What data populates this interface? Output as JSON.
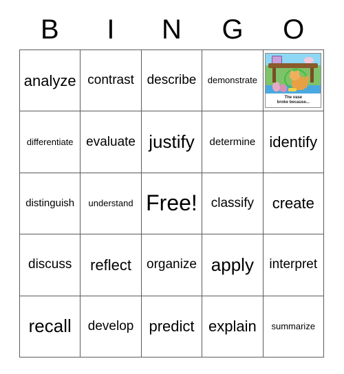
{
  "header": {
    "letters": [
      "B",
      "I",
      "N",
      "G",
      "O"
    ]
  },
  "grid": {
    "rows": [
      [
        {
          "text": "analyze",
          "size": "fs-l"
        },
        {
          "text": "contrast",
          "size": "fs-m"
        },
        {
          "text": "describe",
          "size": "fs-m"
        },
        {
          "text": "demonstrate",
          "size": "fs-xs"
        },
        {
          "type": "image"
        }
      ],
      [
        {
          "text": "differentiate",
          "size": "fs-xs"
        },
        {
          "text": "evaluate",
          "size": "fs-m"
        },
        {
          "text": "justify",
          "size": "fs-xl"
        },
        {
          "text": "determine",
          "size": "fs-s"
        },
        {
          "text": "identify",
          "size": "fs-l"
        }
      ],
      [
        {
          "text": "distinguish",
          "size": "fs-s"
        },
        {
          "text": "understand",
          "size": "fs-xs"
        },
        {
          "text": "Free!",
          "size": "fs-xxl"
        },
        {
          "text": "classify",
          "size": "fs-m"
        },
        {
          "text": "create",
          "size": "fs-l"
        }
      ],
      [
        {
          "text": "discuss",
          "size": "fs-m"
        },
        {
          "text": "reflect",
          "size": "fs-l"
        },
        {
          "text": "organize",
          "size": "fs-m"
        },
        {
          "text": "apply",
          "size": "fs-xl"
        },
        {
          "text": "interpret",
          "size": "fs-m"
        }
      ],
      [
        {
          "text": "recall",
          "size": "fs-xl"
        },
        {
          "text": "develop",
          "size": "fs-m"
        },
        {
          "text": "predict",
          "size": "fs-l"
        },
        {
          "text": "explain",
          "size": "fs-l"
        },
        {
          "text": "summarize",
          "size": "fs-xs"
        }
      ]
    ]
  },
  "picture": {
    "caption_line1": "The vase",
    "caption_line2": "broke because...",
    "alt": "cartoon cat under table with broken vase",
    "colors": {
      "sky": "#7fd4f2",
      "floor": "#7ec26a",
      "rug": "#4aa8e0",
      "table": "#8a5a2b",
      "cat": "#e8a045",
      "vase": "#e9a8c4",
      "halo": "#3fbf3f"
    }
  },
  "style": {
    "grid_border": "#2b2b2b",
    "cell_border": "#5a5a5a",
    "text_color": "#000000",
    "background": "#ffffff"
  }
}
